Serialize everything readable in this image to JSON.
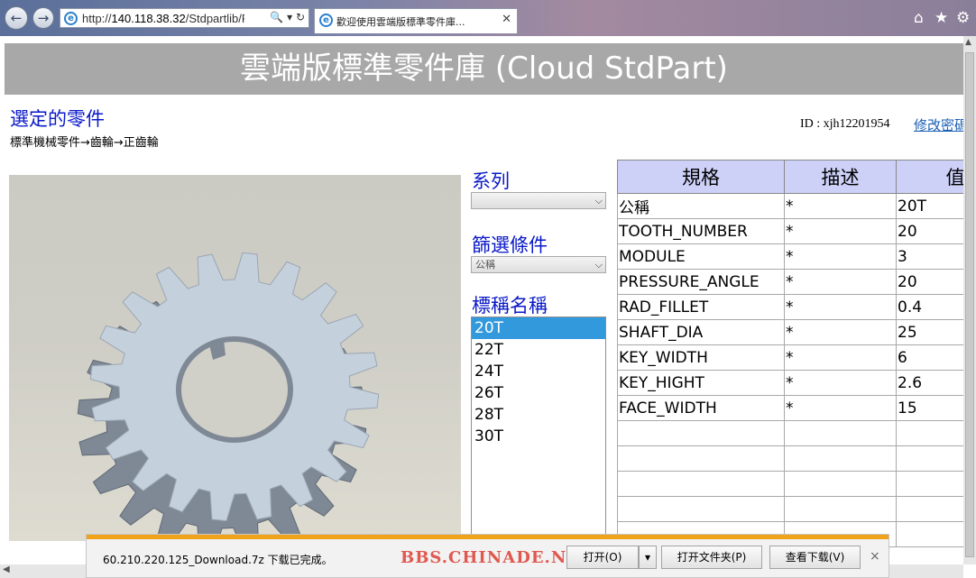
{
  "browser": {
    "back_glyph": "←",
    "forward_glyph": "→",
    "address_prefix": "http://",
    "address_host": "140.118.38.32",
    "address_path": "/Stdpartlib/Pa",
    "address_tools": "🔍 ▾ ↻",
    "tab_title": "歡迎使用雲端版標準零件庫...",
    "tab_close": "✕",
    "icon_home": "home-icon",
    "icon_star": "star-icon",
    "icon_gear": "gear-icon"
  },
  "page": {
    "banner_title": "雲端版標準零件庫 (Cloud StdPart)",
    "selected_title": "選定的零件",
    "breadcrumb": "標準機械零件→齒輪→正齒輪",
    "user_id": "ID : xjh12201954",
    "change_password": "修改密碼"
  },
  "filters": {
    "series_label": "系列",
    "series_value": "",
    "condition_label": "篩選條件",
    "condition_value": "公稱",
    "name_label": "標稱名稱",
    "names": [
      "20T",
      "22T",
      "24T",
      "26T",
      "28T",
      "30T"
    ],
    "selected_name": "20T"
  },
  "spec_table": {
    "headers": [
      "規格",
      "描述",
      "值"
    ],
    "rows": [
      [
        "公稱",
        "*",
        "20T"
      ],
      [
        "TOOTH_NUMBER",
        "*",
        "20"
      ],
      [
        "MODULE",
        "*",
        "3"
      ],
      [
        "PRESSURE_ANGLE",
        "*",
        "20"
      ],
      [
        "RAD_FILLET",
        "*",
        "0.4"
      ],
      [
        "SHAFT_DIA",
        "*",
        "25"
      ],
      [
        "KEY_WIDTH",
        "*",
        "6"
      ],
      [
        "KEY_HIGHT",
        "*",
        "2.6"
      ],
      [
        "FACE_WIDTH",
        "*",
        "15"
      ]
    ],
    "empty_rows": 5
  },
  "download": {
    "message": "60.210.220.125_Download.7z 下载已完成。",
    "open_label": "打开(O)",
    "open_folder_label": "打开文件夹(P)",
    "view_downloads_label": "查看下载(V)",
    "close_glyph": "×",
    "watermark": "BBS.CHINADE.NET"
  },
  "colors": {
    "accent_blue": "#0a19c8",
    "header_bg": "#cdd0f7",
    "list_selected": "#3399dd",
    "banner_bg": "#a8a8a8",
    "download_accent": "#f0a21a",
    "gear_color": "#c4d0dc"
  }
}
